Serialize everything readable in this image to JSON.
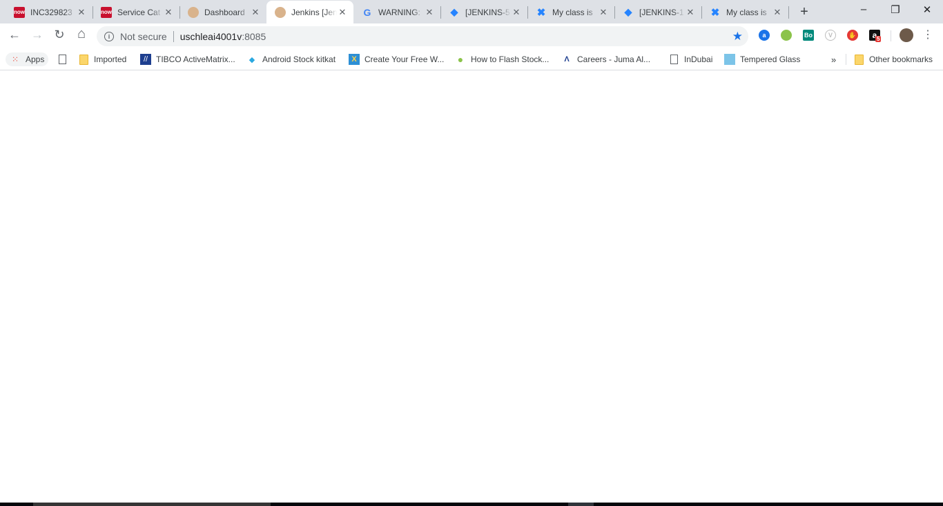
{
  "tabs": [
    {
      "title": "INC329823",
      "icon": "servicenow-icon",
      "active": false
    },
    {
      "title": "Service Cat",
      "icon": "servicenow-icon",
      "active": false
    },
    {
      "title": "Dashboard",
      "icon": "jenkins-icon",
      "active": false
    },
    {
      "title": "Jenkins [Jen",
      "icon": "jenkins-icon",
      "active": true
    },
    {
      "title": "WARNING:",
      "icon": "google-icon",
      "active": false
    },
    {
      "title": "[JENKINS-5",
      "icon": "jira-icon",
      "active": false
    },
    {
      "title": "My class is",
      "icon": "confluence-icon",
      "active": false
    },
    {
      "title": "[JENKINS-1",
      "icon": "jira-icon",
      "active": false
    },
    {
      "title": "My class is",
      "icon": "confluence-icon",
      "active": false
    }
  ],
  "tab_close": "✕",
  "new_tab": "+",
  "window": {
    "minimize": "–",
    "restore": "❐",
    "close": "✕"
  },
  "toolbar": {
    "back": "←",
    "forward": "→",
    "reload": "↻",
    "home": "⌂"
  },
  "omnibox": {
    "security": "Not secure",
    "host": "uschleai4001v",
    "port": ":8085"
  },
  "extensions": [
    {
      "name": "a",
      "color": "#1a73e8"
    },
    {
      "name": "",
      "color": "#8bc34a"
    },
    {
      "name": "Bo",
      "color": "#00897b"
    },
    {
      "name": "V",
      "color": "#bdbdbd"
    },
    {
      "name": "✋",
      "color": "#e53935"
    },
    {
      "name": "a",
      "color": "#111111",
      "badge": "5"
    }
  ],
  "bookmarks": {
    "apps": "Apps",
    "items": [
      {
        "label": "",
        "icon": "page"
      },
      {
        "label": "Imported",
        "icon": "folder"
      },
      {
        "label": "TIBCO ActiveMatrix...",
        "icon": "tibco"
      },
      {
        "label": "Android Stock kitkat",
        "icon": "diamond"
      },
      {
        "label": "Create Your Free W...",
        "icon": "x-logo"
      },
      {
        "label": "How to Flash Stock...",
        "icon": "android"
      },
      {
        "label": "Careers - Juma Al...",
        "icon": "juma"
      },
      {
        "label": "InDubai",
        "icon": "page"
      },
      {
        "label": "Tempered Glass",
        "icon": "image"
      }
    ],
    "overflow": "»",
    "other": "Other bookmarks"
  }
}
